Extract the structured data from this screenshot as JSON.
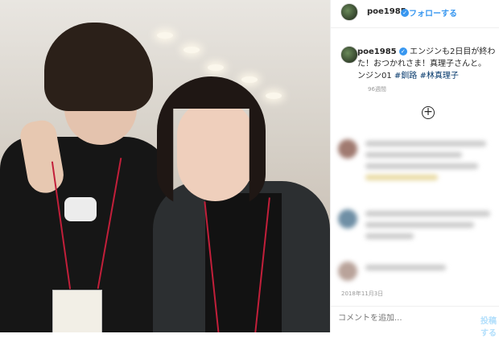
{
  "header": {
    "username": "poe1985",
    "verified_icon": "verified-badge-icon",
    "follow_label": "フォローする"
  },
  "caption": {
    "username": "poe1985",
    "text_line1": "エンジンも2日目が終わ",
    "text_line2": "た！おつかれさま！真理子さんと。",
    "text_line3_plain": "ンジン01 ",
    "hashtag1": "#釧路",
    "hashtag2": "#林真理子",
    "time_ago": "96週間"
  },
  "load_more_icon": "plus-circle-icon",
  "post_date": "2018年11月3日",
  "comment": {
    "placeholder": "コメントを追加...",
    "post_label": "投稿する"
  },
  "colors": {
    "accent": "#3897f0",
    "hashtag": "#003569",
    "text": "#262626",
    "muted": "#999999"
  }
}
